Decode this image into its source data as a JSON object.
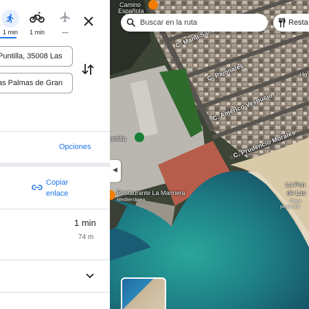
{
  "modes": [
    {
      "name": "walk",
      "label": "1 min"
    },
    {
      "name": "bike",
      "label": "1 min"
    },
    {
      "name": "flight",
      "label": "—"
    }
  ],
  "route": {
    "origin": "Puntilla, 35008 Las",
    "destination": "as Palmas de Gran"
  },
  "options_label": "Opciones",
  "copy_link": {
    "line1": "Copiar",
    "line2": "enlace"
  },
  "result": {
    "duration": "1 min",
    "distance": "74 m"
  },
  "map": {
    "search_placeholder": "Buscar en la ruta",
    "restaurants_chip": "Resta",
    "labels": {
      "espanola": "Española",
      "camino": "Camino",
      "manu": "C. Manu Sanc",
      "pajonales": "C. Pajonales",
      "americo": "C. Américo Vespucio",
      "prudencio": "C. Prudencio Morales",
      "puntilla": "untilla",
      "marinera": "Restaurante La Marinera",
      "marinera_sub": "Mediterránea",
      "playa1": "La Pun",
      "playa2": "de Las",
      "playa3": "Plays",
      "playa4": "pesca loc",
      "ho": "Ho"
    }
  },
  "colors": {
    "accent": "#1a73e8",
    "pin_orange": "#f57c00",
    "pin_green": "#188038"
  }
}
